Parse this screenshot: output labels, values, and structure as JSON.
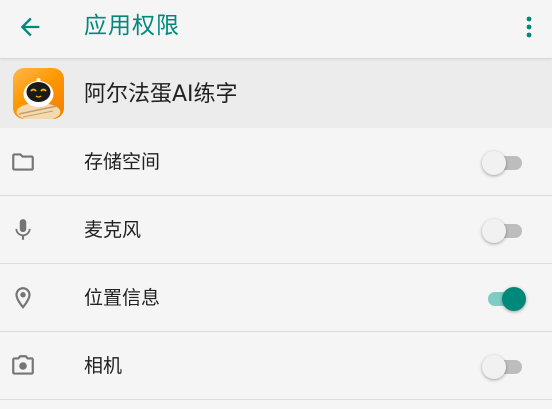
{
  "appbar": {
    "title": "应用权限",
    "back_icon": "arrow-left-icon",
    "more_icon": "more-vert-icon"
  },
  "app": {
    "name": "阿尔法蛋AI练字",
    "icon": "app-mascot-icon"
  },
  "permissions": [
    {
      "label": "存储空间",
      "icon": "folder-icon",
      "enabled": false
    },
    {
      "label": "麦克风",
      "icon": "microphone-icon",
      "enabled": false
    },
    {
      "label": "位置信息",
      "icon": "location-pin-icon",
      "enabled": true
    },
    {
      "label": "相机",
      "icon": "camera-icon",
      "enabled": false
    }
  ],
  "colors": {
    "accent": "#00897b",
    "accent_track": "#80cbc4",
    "icon_gray": "#757575",
    "background": "#f5f5f5",
    "header_bg": "#ececec"
  }
}
